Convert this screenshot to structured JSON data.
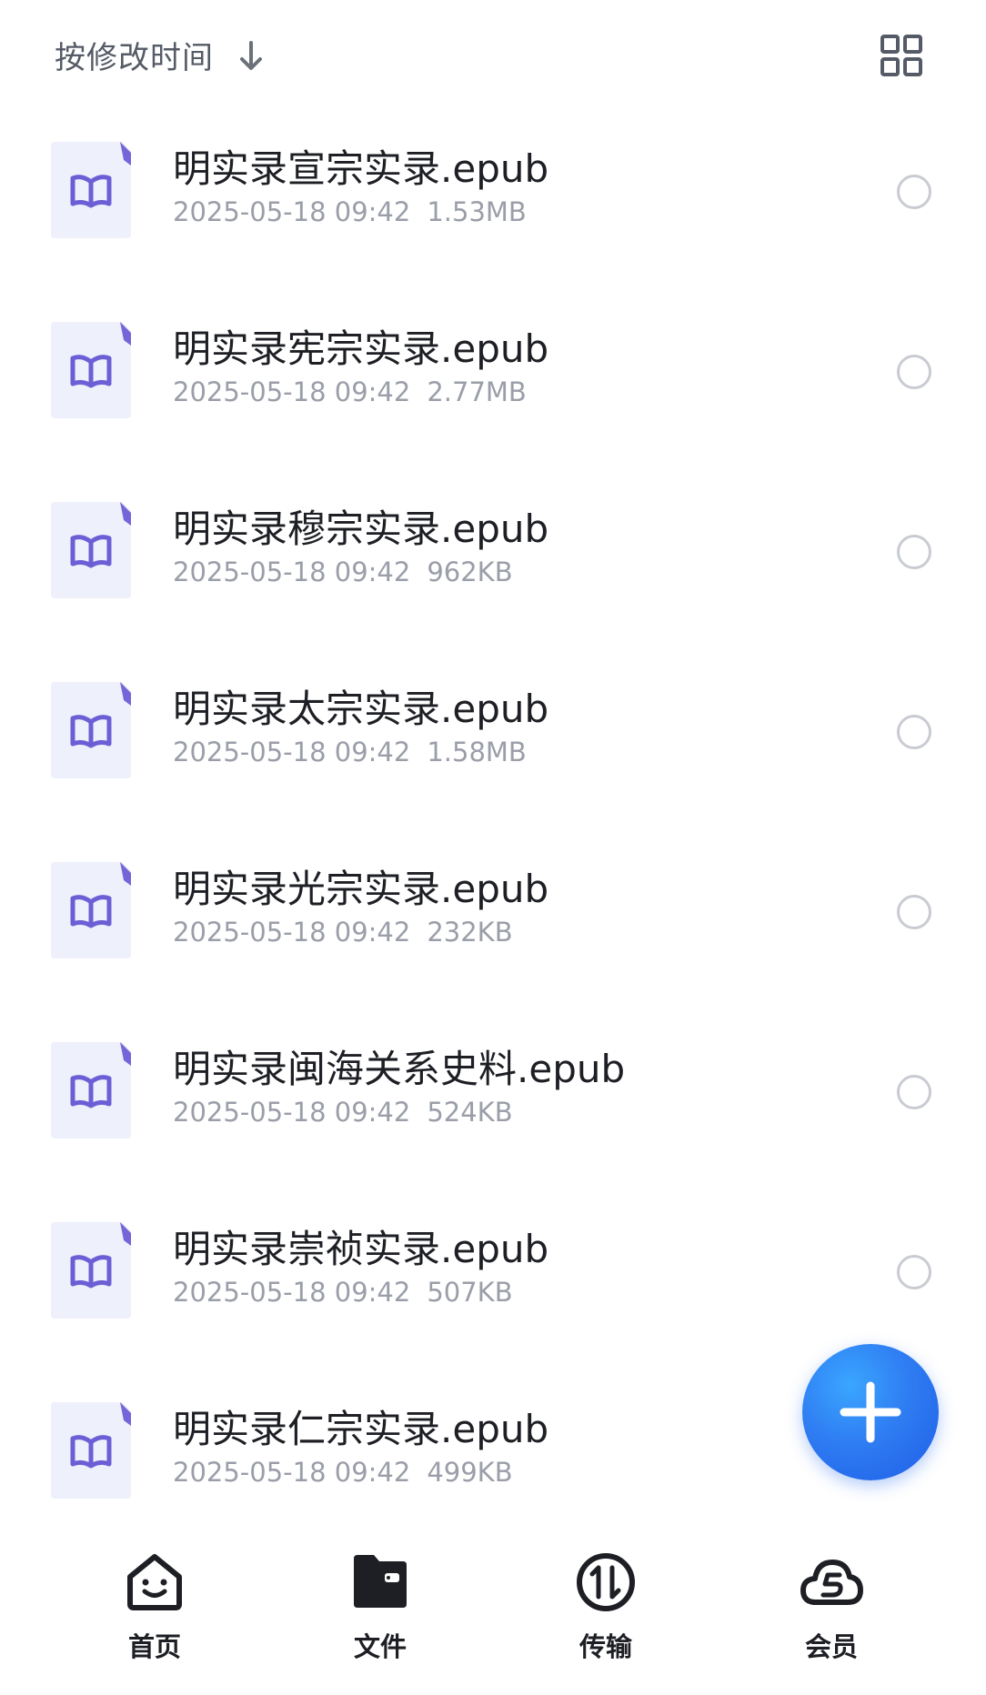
{
  "header": {
    "sort_label": "按修改时间",
    "sort_direction_icon": "arrow-down-icon",
    "view_toggle_icon": "grid-view-icon"
  },
  "files": [
    {
      "name": "明实录宣宗实录.epub",
      "date": "2025-05-18 09:42",
      "size": "1.53MB",
      "icon": "book-icon"
    },
    {
      "name": "明实录宪宗实录.epub",
      "date": "2025-05-18 09:42",
      "size": "2.77MB",
      "icon": "book-icon"
    },
    {
      "name": "明实录穆宗实录.epub",
      "date": "2025-05-18 09:42",
      "size": "962KB",
      "icon": "book-icon"
    },
    {
      "name": "明实录太宗实录.epub",
      "date": "2025-05-18 09:42",
      "size": "1.58MB",
      "icon": "book-icon"
    },
    {
      "name": "明实录光宗实录.epub",
      "date": "2025-05-18 09:42",
      "size": "232KB",
      "icon": "book-icon"
    },
    {
      "name": "明实录闽海关系史料.epub",
      "date": "2025-05-18 09:42",
      "size": "524KB",
      "icon": "book-icon"
    },
    {
      "name": "明实录崇祯实录.epub",
      "date": "2025-05-18 09:42",
      "size": "507KB",
      "icon": "book-icon"
    },
    {
      "name": "明实录仁宗实录.epub",
      "date": "2025-05-18 09:42",
      "size": "499KB",
      "icon": "book-icon"
    }
  ],
  "fab": {
    "icon": "plus-icon",
    "color": "#2f7df2"
  },
  "nav": [
    {
      "label": "首页",
      "icon": "home-smile-icon"
    },
    {
      "label": "文件",
      "icon": "folder-icon",
      "active": true
    },
    {
      "label": "传输",
      "icon": "transfer-icon"
    },
    {
      "label": "会员",
      "icon": "cloud-vip-icon"
    }
  ],
  "colors": {
    "accent": "#2f7df2",
    "file_icon": "#6c5fd6",
    "file_icon_bg": "#eef0fb"
  }
}
